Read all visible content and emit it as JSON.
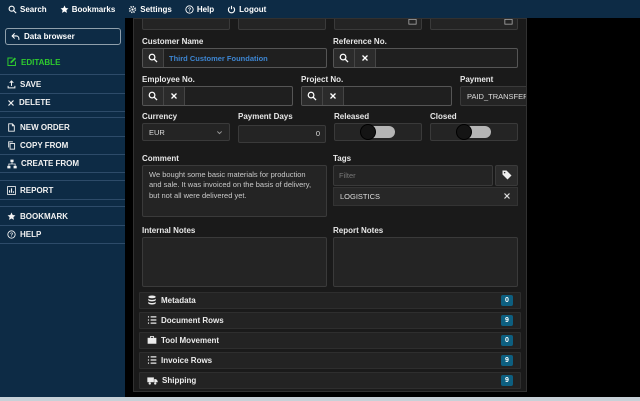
{
  "topbar": {
    "items": [
      {
        "label": "Search",
        "icon": "search-icon"
      },
      {
        "label": "Bookmarks",
        "icon": "star-icon"
      },
      {
        "label": "Settings",
        "icon": "gear-icon"
      },
      {
        "label": "Help",
        "icon": "help-icon"
      },
      {
        "label": "Logout",
        "icon": "power-icon"
      }
    ]
  },
  "sidebar": {
    "back_button": {
      "label": "Data browser",
      "icon": "back-arrow-icon"
    },
    "status": {
      "label": "EDITABLE",
      "icon": "edit-icon"
    },
    "groups": [
      {
        "items": [
          {
            "label": "SAVE",
            "icon": "save-upload-icon"
          },
          {
            "label": "DELETE",
            "icon": "x-icon"
          }
        ]
      },
      {
        "items": [
          {
            "label": "NEW ORDER",
            "icon": "file-icon"
          },
          {
            "label": "COPY FROM",
            "icon": "copy-icon"
          },
          {
            "label": "CREATE FROM",
            "icon": "sitemap-icon"
          }
        ]
      },
      {
        "items": [
          {
            "label": "REPORT",
            "icon": "chart-icon"
          }
        ]
      },
      {
        "items": [
          {
            "label": "BOOKMARK",
            "icon": "star-icon"
          },
          {
            "label": "HELP",
            "icon": "help-icon"
          }
        ]
      }
    ]
  },
  "form": {
    "customer_name": {
      "label": "Customer Name",
      "value": "Third Customer Foundation"
    },
    "reference_no": {
      "label": "Reference No.",
      "value": ""
    },
    "employee_no": {
      "label": "Employee No.",
      "value": ""
    },
    "project_no": {
      "label": "Project No.",
      "value": ""
    },
    "payment": {
      "label": "Payment",
      "value": "PAID_TRANSFER"
    },
    "currency": {
      "label": "Currency",
      "value": "EUR"
    },
    "payment_days": {
      "label": "Payment Days",
      "value": "0"
    },
    "released": {
      "label": "Released",
      "value": "off"
    },
    "closed": {
      "label": "Closed",
      "value": "off"
    },
    "comment": {
      "label": "Comment",
      "value": "We bought some basic materials for production and sale. It was invoiced on the basis of delivery, but not all were delivered yet."
    },
    "tags": {
      "label": "Tags",
      "filter_placeholder": "Filter",
      "selected": [
        "LOGISTICS"
      ]
    },
    "internal_notes": {
      "label": "Internal Notes",
      "value": ""
    },
    "report_notes": {
      "label": "Report Notes",
      "value": ""
    }
  },
  "sections": [
    {
      "label": "Metadata",
      "icon": "database-icon",
      "count": "0"
    },
    {
      "label": "Document Rows",
      "icon": "list-icon",
      "count": "9"
    },
    {
      "label": "Tool Movement",
      "icon": "briefcase-icon",
      "count": "0"
    },
    {
      "label": "Invoice Rows",
      "icon": "list-icon",
      "count": "9"
    },
    {
      "label": "Shipping",
      "icon": "truck-icon",
      "count": "9"
    }
  ],
  "colors": {
    "topbar_bg": "#0d2b45",
    "panel_bg": "#1a1a1a",
    "editable_green": "#2fca2f",
    "link_blue": "#3d85d1",
    "badge_teal": "#0d5f80"
  }
}
